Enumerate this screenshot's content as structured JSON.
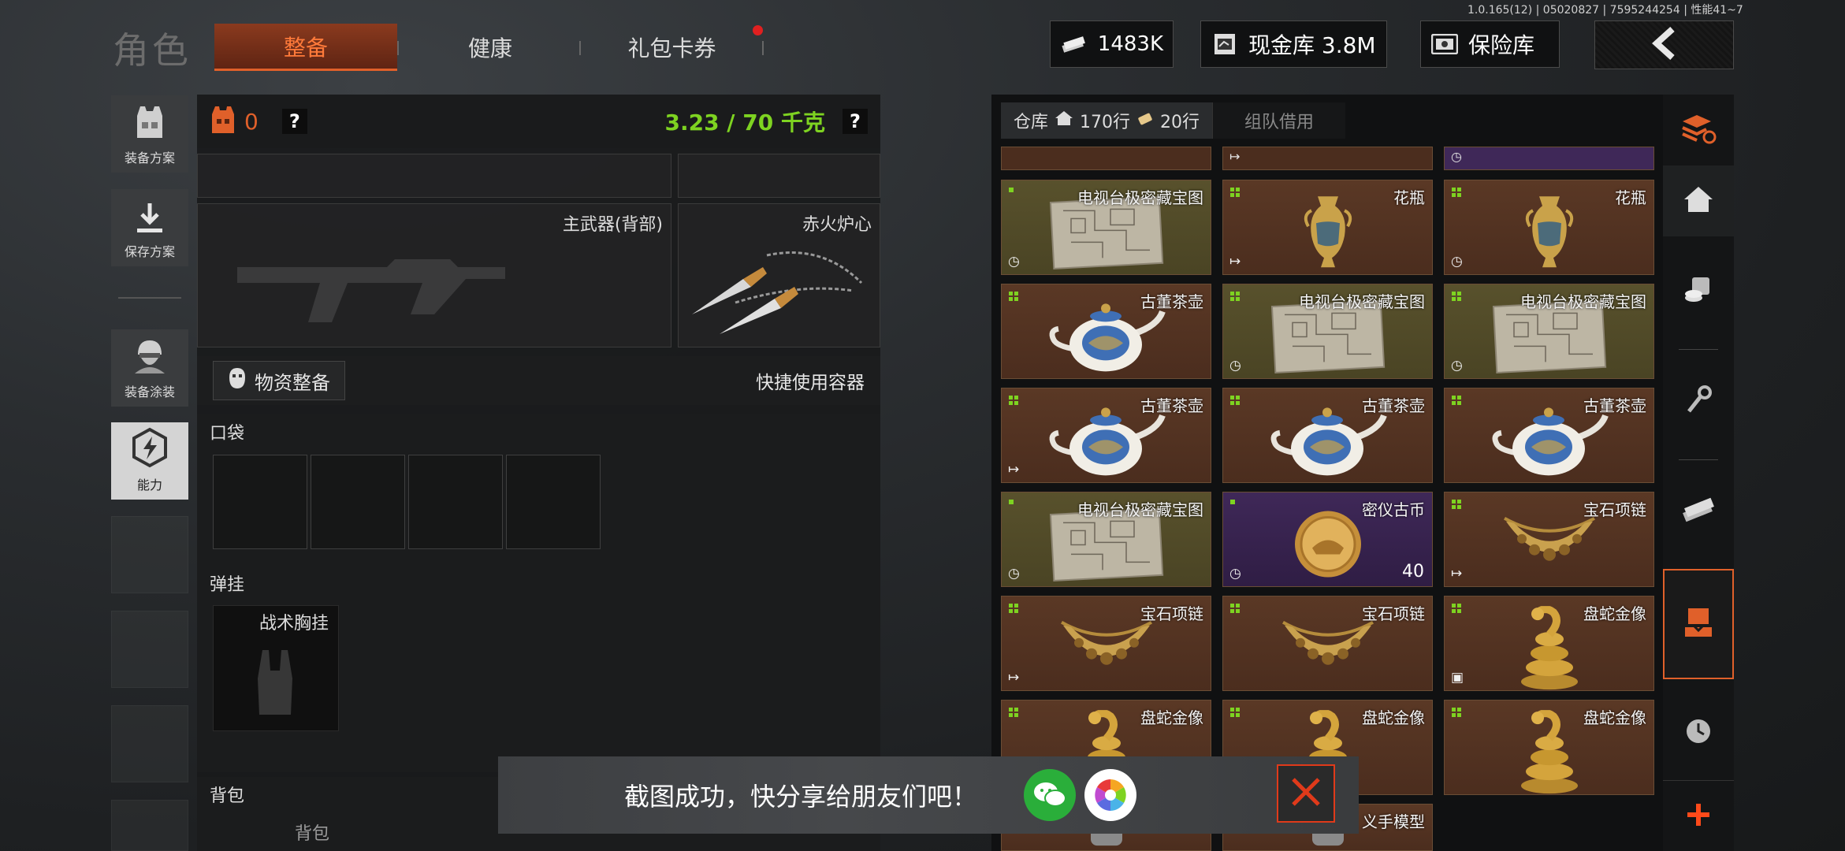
{
  "version": "1.0.165(12) | 05020827 | 7595244254 | 性能41~7",
  "header": {
    "title": "角色",
    "tabs": [
      {
        "label": "整备",
        "active": true
      },
      {
        "label": "健康",
        "active": false
      },
      {
        "label": "礼包卡券",
        "active": false,
        "badge": true
      }
    ],
    "money": "1483K",
    "cash_vault": "现金库 3.8M",
    "safe": "保险库"
  },
  "sidebar": {
    "items": [
      {
        "label": "装备方案",
        "icon": "vest-icon"
      },
      {
        "label": "保存方案",
        "icon": "download-icon"
      },
      {
        "label": "装备涂装",
        "icon": "soldier-icon"
      },
      {
        "label": "能力",
        "icon": "lightning-hex-icon",
        "active": true
      }
    ]
  },
  "loadout": {
    "armor_count": "0",
    "help": "?",
    "weight": "3.23 / 70 千克",
    "primary_weapon": "主武器(背部)",
    "melee": "赤火炉心",
    "supplies_button": "物资整备",
    "quick_container": "快捷使用容器",
    "pocket_label": "口袋",
    "rig_label": "弹挂",
    "rig_item": "战术胸挂",
    "backpack_label": "背包",
    "backpack_item": "背包"
  },
  "warehouse": {
    "tab_label": "仓库",
    "rows_home": "170行",
    "rows_ticket": "20行",
    "team_tab": "组队借用",
    "items": [
      {
        "name": "电视台极密藏宝图",
        "bg": "olive",
        "mark": "single",
        "bottom_icon": "clock-icon",
        "count": "",
        "art": "map"
      },
      {
        "name": "花瓶",
        "bg": "brown",
        "mark": "grid",
        "bottom_icon": "exit-icon",
        "count": "",
        "art": "vase"
      },
      {
        "name": "花瓶",
        "bg": "brown",
        "mark": "grid",
        "bottom_icon": "clock-icon",
        "count": "",
        "art": "vase"
      },
      {
        "name": "古董茶壶",
        "bg": "brown",
        "mark": "grid",
        "bottom_icon": "",
        "count": "",
        "art": "teapot"
      },
      {
        "name": "电视台极密藏宝图",
        "bg": "olive",
        "mark": "grid",
        "bottom_icon": "clock-icon",
        "count": "",
        "art": "map"
      },
      {
        "name": "电视台极密藏宝图",
        "bg": "olive",
        "mark": "grid",
        "bottom_icon": "clock-icon",
        "count": "",
        "art": "map"
      },
      {
        "name": "古董茶壶",
        "bg": "brown",
        "mark": "grid",
        "bottom_icon": "exit-icon",
        "count": "",
        "art": "teapot"
      },
      {
        "name": "古董茶壶",
        "bg": "brown",
        "mark": "grid",
        "bottom_icon": "",
        "count": "",
        "art": "teapot"
      },
      {
        "name": "古董茶壶",
        "bg": "brown",
        "mark": "grid",
        "bottom_icon": "",
        "count": "",
        "art": "teapot"
      },
      {
        "name": "电视台极密藏宝图",
        "bg": "olive",
        "mark": "single",
        "bottom_icon": "clock-icon",
        "count": "",
        "art": "map"
      },
      {
        "name": "密仪古币",
        "bg": "purple",
        "mark": "single",
        "bottom_icon": "clock-icon",
        "count": "40",
        "art": "coin"
      },
      {
        "name": "宝石项链",
        "bg": "brown",
        "mark": "grid",
        "bottom_icon": "exit-icon",
        "count": "",
        "art": "necklace"
      },
      {
        "name": "宝石项链",
        "bg": "brown",
        "mark": "grid",
        "bottom_icon": "exit-icon",
        "count": "",
        "art": "necklace"
      },
      {
        "name": "宝石项链",
        "bg": "brown",
        "mark": "grid",
        "bottom_icon": "",
        "count": "",
        "art": "necklace"
      },
      {
        "name": "盘蛇金像",
        "bg": "brown",
        "mark": "grid",
        "bottom_icon": "box-icon",
        "count": "",
        "art": "snake"
      },
      {
        "name": "盘蛇金像",
        "bg": "brown",
        "mark": "grid",
        "bottom_icon": "",
        "count": "",
        "art": "snake"
      },
      {
        "name": "盘蛇金像",
        "bg": "brown",
        "mark": "grid",
        "bottom_icon": "",
        "count": "",
        "art": "snake"
      },
      {
        "name": "盘蛇金像",
        "bg": "brown",
        "mark": "grid",
        "bottom_icon": "",
        "count": "",
        "art": "snake"
      },
      {
        "name": "义手模型",
        "bg": "brown",
        "mark": "grid",
        "bottom_icon": "",
        "count": "",
        "art": "hand"
      },
      {
        "name": "义手模型",
        "bg": "brown",
        "mark": "grid",
        "bottom_icon": "",
        "count": "",
        "art": "hand"
      }
    ]
  },
  "toast": {
    "message": "截图成功，快分享给朋友们吧！"
  },
  "colors": {
    "accent_orange": "#e0602a",
    "weight_green": "#7ed321",
    "close_red": "#e03a1a"
  }
}
